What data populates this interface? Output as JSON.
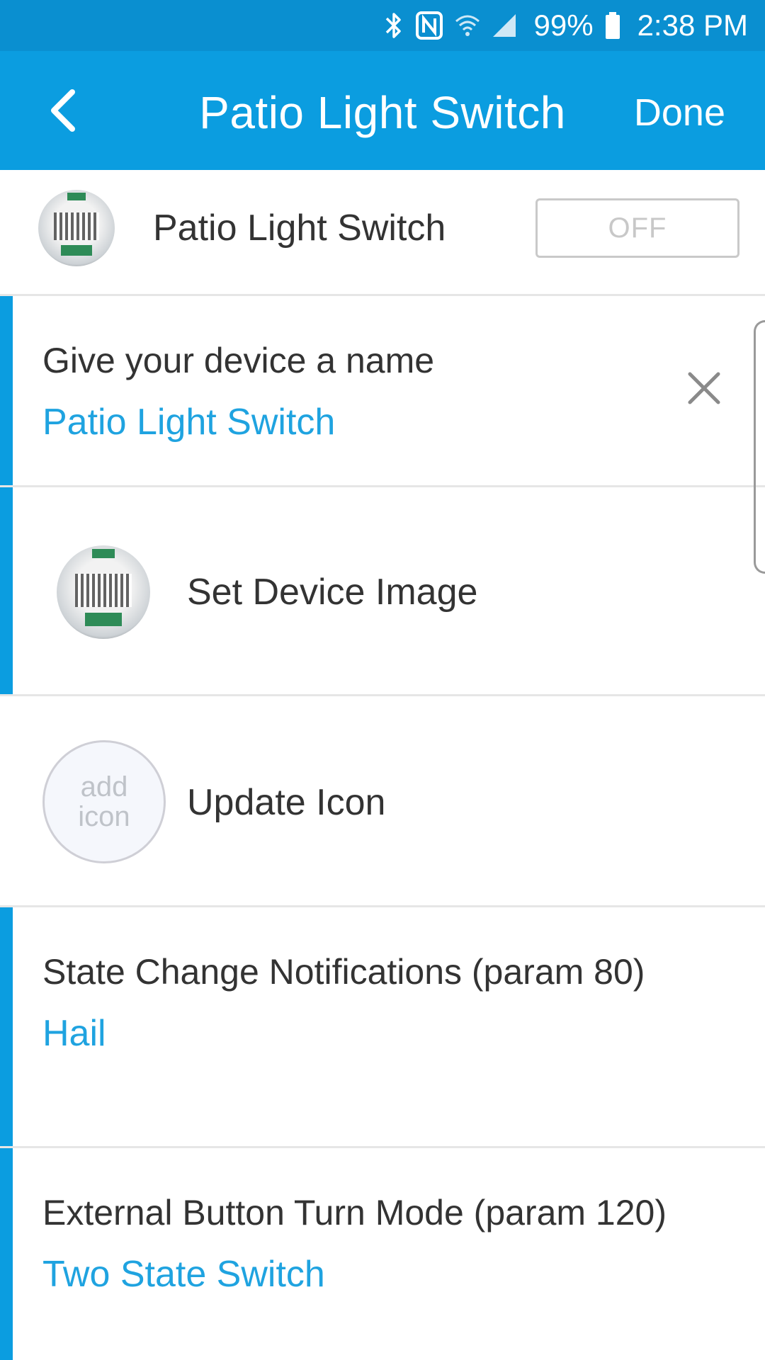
{
  "status_bar": {
    "battery_text": "99%",
    "time": "2:38 PM",
    "icons": [
      "bluetooth-icon",
      "nfc-icon",
      "wifi-icon",
      "cellular-signal-icon",
      "battery-icon"
    ]
  },
  "app_bar": {
    "title": "Patio Light Switch",
    "done_label": "Done",
    "back_icon": "chevron-left-icon"
  },
  "device": {
    "name": "Patio Light Switch",
    "toggle_state": "OFF"
  },
  "name_setting": {
    "label": "Give your device a name",
    "value": "Patio Light Switch",
    "clear_icon": "close-icon"
  },
  "image_setting": {
    "label": "Set Device Image"
  },
  "icon_setting": {
    "label": "Update Icon",
    "placeholder": "add\nicon"
  },
  "notifications_setting": {
    "label": "State Change Notifications (param 80)",
    "value": "Hail"
  },
  "external_button_setting": {
    "label": "External Button Turn Mode (param 120)",
    "value": "Two State Switch"
  },
  "colors": {
    "accent": "#0b9de0",
    "status_bar": "#0a8fd0",
    "value_text": "#1fa3e0"
  }
}
